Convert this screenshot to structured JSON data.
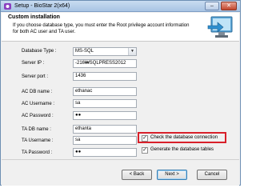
{
  "window": {
    "title": "Setup - BioStar 2(x64)"
  },
  "header": {
    "title": "Custom installation",
    "description": "If you choose database type, you must enter the Root privilege account information for both AC user and TA user."
  },
  "form": {
    "database_type_label": "Database Type :",
    "database_type_value": "MS-SQL",
    "server_ip_label": "Server IP :",
    "server_ip_value": "-216₩SQLPRESS2012",
    "server_port_label": "Server port :",
    "server_port_value": "1436",
    "ac_db_name_label": "AC DB name :",
    "ac_db_name_value": "ethanac",
    "ac_username_label": "AC Username :",
    "ac_username_value": "sa",
    "ac_password_label": "AC Password :",
    "ac_password_value": "●●",
    "ta_db_name_label": "TA DB name :",
    "ta_db_name_value": "ethanta",
    "ta_username_label": "TA Username :",
    "ta_username_value": "sa",
    "ta_password_label": "TA Password :",
    "ta_password_value": "●●"
  },
  "options": {
    "check_db_connection_label": "Check the database connection",
    "check_db_connection_checked": true,
    "generate_tables_label": "Generate the database tables",
    "generate_tables_checked": true,
    "check_mark": "✓"
  },
  "buttons": {
    "back_label": "< Back",
    "next_label": "Next >",
    "cancel_label": "Cancel"
  },
  "icons": {
    "minimize": "minimize-icon",
    "close": "close-icon",
    "app": "biostar-app-icon",
    "header_logo": "setup-computer-icon"
  },
  "colors": {
    "highlight_box": "#d8202a",
    "titlebar": "#a8c4e4"
  }
}
